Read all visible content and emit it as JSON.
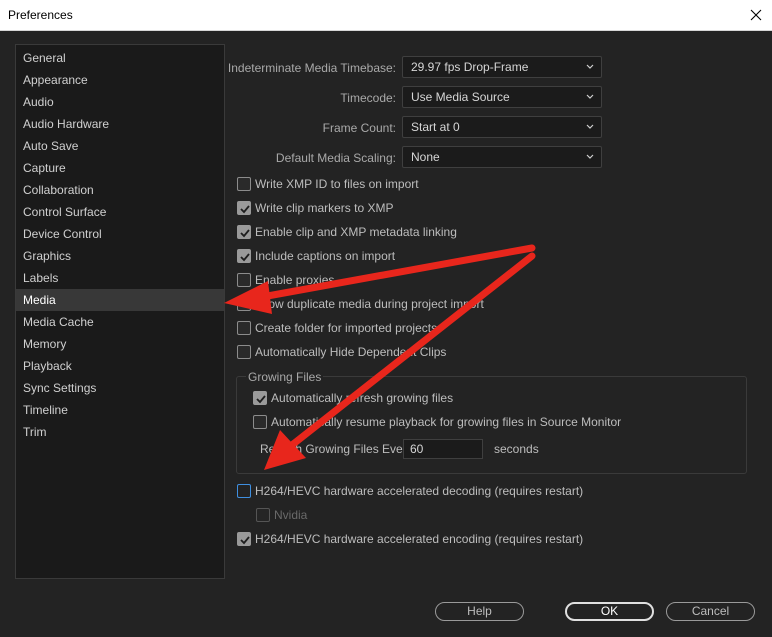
{
  "window": {
    "title": "Preferences"
  },
  "sidebar": {
    "items": [
      {
        "label": "General"
      },
      {
        "label": "Appearance"
      },
      {
        "label": "Audio"
      },
      {
        "label": "Audio Hardware"
      },
      {
        "label": "Auto Save"
      },
      {
        "label": "Capture"
      },
      {
        "label": "Collaboration"
      },
      {
        "label": "Control Surface"
      },
      {
        "label": "Device Control"
      },
      {
        "label": "Graphics"
      },
      {
        "label": "Labels"
      },
      {
        "label": "Media",
        "selected": true
      },
      {
        "label": "Media Cache"
      },
      {
        "label": "Memory"
      },
      {
        "label": "Playback"
      },
      {
        "label": "Sync Settings"
      },
      {
        "label": "Timeline"
      },
      {
        "label": "Trim"
      }
    ]
  },
  "media": {
    "timebase": {
      "label": "Indeterminate Media Timebase:",
      "value": "29.97 fps Drop-Frame"
    },
    "timecode": {
      "label": "Timecode:",
      "value": "Use Media Source"
    },
    "frame_count": {
      "label": "Frame Count:",
      "value": "Start at 0"
    },
    "scaling": {
      "label": "Default Media Scaling:",
      "value": "None"
    },
    "checks": [
      {
        "label": "Write XMP ID to files on import",
        "checked": false
      },
      {
        "label": "Write clip markers to XMP",
        "checked": true
      },
      {
        "label": "Enable clip and XMP metadata linking",
        "checked": true
      },
      {
        "label": "Include captions on import",
        "checked": true
      },
      {
        "label": "Enable proxies",
        "checked": false
      },
      {
        "label": "Allow duplicate media during project import",
        "checked": false
      },
      {
        "label": "Create folder for imported projects",
        "checked": false
      },
      {
        "label": "Automatically Hide Dependent Clips",
        "checked": false
      }
    ],
    "growing": {
      "title": "Growing Files",
      "auto_refresh": {
        "label": "Automatically refresh growing files",
        "checked": true
      },
      "auto_resume": {
        "label": "Automatically resume playback for growing files in Source Monitor",
        "checked": false
      },
      "refresh_label": "Refresh Growing Files Every",
      "refresh_value": "60",
      "refresh_unit": "seconds"
    },
    "h264_decoding": {
      "label": "H264/HEVC hardware accelerated decoding (requires restart)",
      "checked": false
    },
    "nvidia": {
      "label": "Nvidia",
      "checked": false
    },
    "h264_encoding": {
      "label": "H264/HEVC hardware accelerated encoding (requires restart)",
      "checked": true
    }
  },
  "buttons": {
    "help": "Help",
    "ok": "OK",
    "cancel": "Cancel"
  },
  "colors": {
    "accent_arrow": "#e8261c",
    "background": "#232323",
    "sidebar": "#1a1a1a",
    "focus": "#3f8fe0"
  },
  "icons": {
    "close": "close-icon",
    "chevron": "chevron-down-icon",
    "check": "checkmark-icon"
  }
}
